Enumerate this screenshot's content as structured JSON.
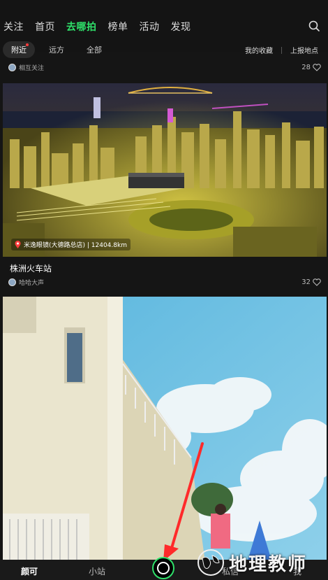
{
  "topnav": {
    "tabs": [
      {
        "label": "关注",
        "active": false
      },
      {
        "label": "首页",
        "active": false
      },
      {
        "label": "去哪拍",
        "active": true
      },
      {
        "label": "榜单",
        "active": false
      },
      {
        "label": "活动",
        "active": false
      },
      {
        "label": "发现",
        "active": false
      }
    ],
    "search_icon": "search-icon",
    "accent_color": "#2fe06a"
  },
  "subtabs": {
    "chips": [
      {
        "label": "附近",
        "active": true
      },
      {
        "label": "远方",
        "active": false
      },
      {
        "label": "全部",
        "active": false
      }
    ],
    "my_favorites": "我的收藏",
    "report_place": "上报地点"
  },
  "cards": [
    {
      "author": "相互关注",
      "likes": "28"
    },
    {
      "location": "米逸眼镜(大德路总店) | 12404.8km",
      "title": "株洲火车站",
      "author": "哈哈大声",
      "likes": "32"
    }
  ],
  "bottombar": {
    "items": [
      "颜可",
      "小站",
      "私信",
      "我"
    ],
    "camera_icon": "camera-icon"
  },
  "watermark": {
    "text": "地理教师"
  }
}
